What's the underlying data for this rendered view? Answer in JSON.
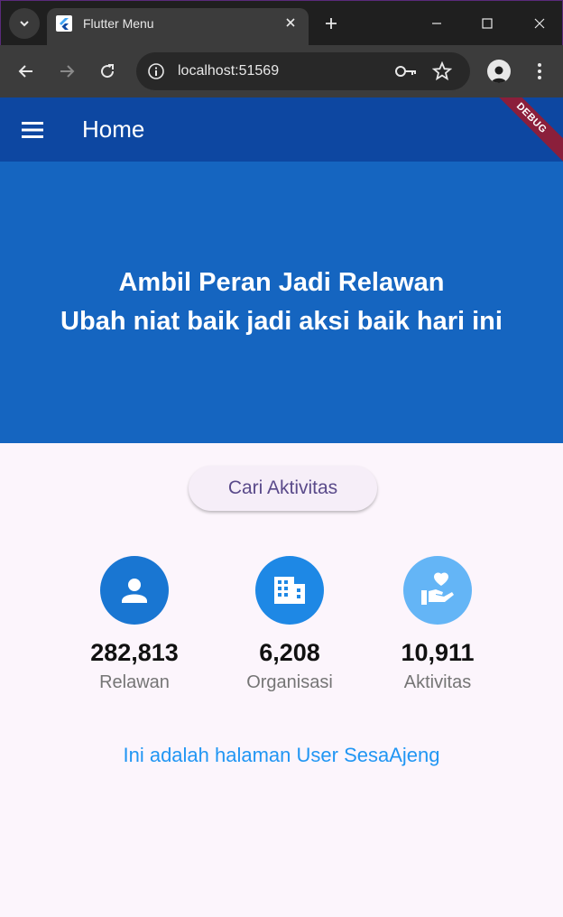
{
  "browser": {
    "tab_title": "Flutter Menu",
    "url": "localhost:51569"
  },
  "app": {
    "title": "Home",
    "debug_banner": "DEBUG",
    "hero": {
      "line1": "Ambil Peran Jadi Relawan",
      "line2": "Ubah niat baik jadi aksi baik hari ini"
    },
    "cta_label": "Cari Aktivitas",
    "stats": [
      {
        "value": "282,813",
        "label": "Relawan",
        "icon": "person-icon",
        "color": "#1976d2"
      },
      {
        "value": "6,208",
        "label": "Organisasi",
        "icon": "building-icon",
        "color": "#1e88e5"
      },
      {
        "value": "10,911",
        "label": "Aktivitas",
        "icon": "volunteer-hand-heart-icon",
        "color": "#64b5f6"
      }
    ],
    "footer_text": "Ini adalah halaman User SesaAjeng"
  },
  "colors": {
    "appbar": "#0d47a1",
    "hero": "#1565c0",
    "page_bg": "#fcf5fc",
    "link": "#2196f3"
  }
}
